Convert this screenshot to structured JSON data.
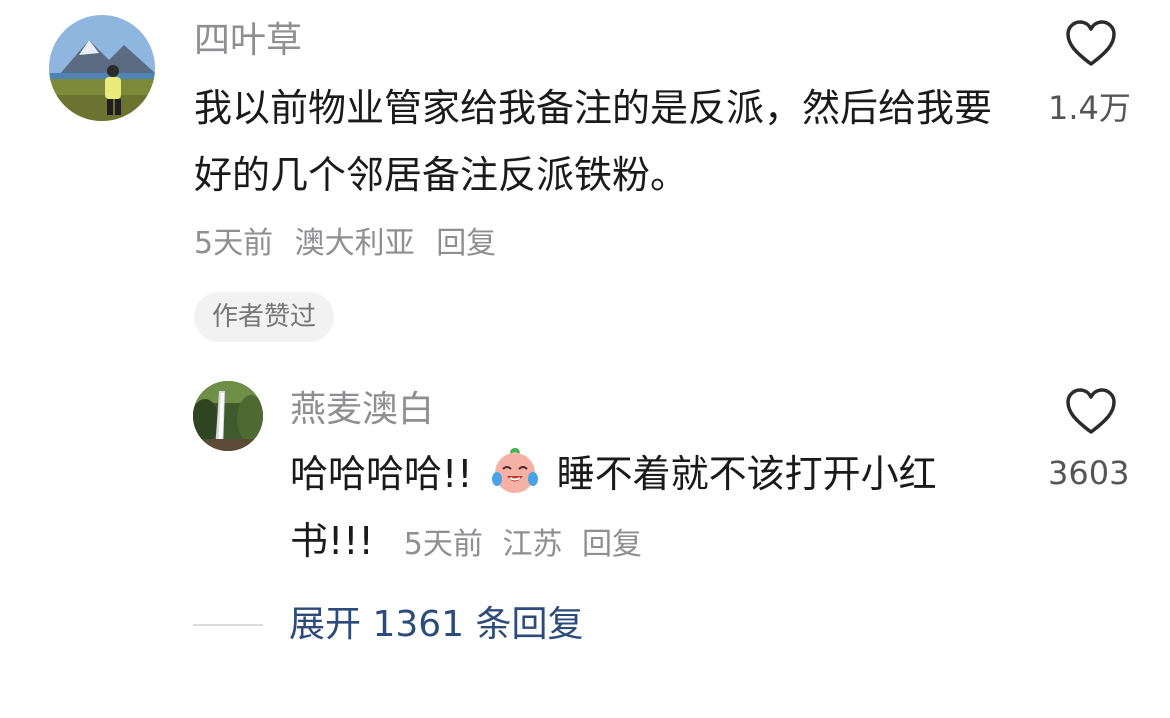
{
  "comment": {
    "username": "四叶草",
    "text": "我以前物业管家给我备注的是反派，然后给我要好的几个邻居备注反派铁粉。",
    "time": "5天前",
    "location": "澳大利亚",
    "reply_label": "回复",
    "badge": "作者赞过",
    "like_count": "1.4万",
    "like_icon": "heart-outline-icon"
  },
  "reply": {
    "username": "燕麦澳白",
    "text_before_emoji": "哈哈哈哈!!",
    "emoji": "crying-laughing-face",
    "text_after_emoji": "睡不着就不该打开小红书!!!",
    "time": "5天前",
    "location": "江苏",
    "reply_label": "回复",
    "like_count": "3603",
    "like_icon": "heart-outline-icon"
  },
  "expand_replies": "展开 1361 条回复",
  "colors": {
    "text_primary": "#1a1a1a",
    "text_secondary": "#8e8e93",
    "link_blue": "#2c4b7a",
    "badge_bg": "#f2f2f2"
  }
}
